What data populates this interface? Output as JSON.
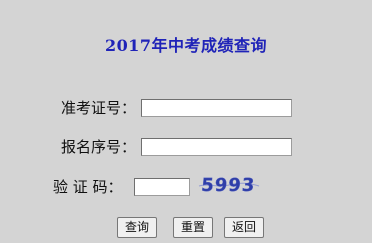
{
  "page": {
    "title": "2017年中考成绩查询"
  },
  "form": {
    "exam_number": {
      "label": "准考证号：",
      "value": "",
      "placeholder": ""
    },
    "registration_number": {
      "label": "报名序号：",
      "value": "",
      "placeholder": ""
    },
    "captcha": {
      "label": "验 证 码：",
      "value": "",
      "placeholder": "",
      "image_text": "5993"
    }
  },
  "buttons": {
    "query_label": "查询",
    "reset_label": "重置",
    "back_label": "返回"
  },
  "colors": {
    "background": "#d4d4d4",
    "title": "#1f23b8",
    "captcha_text": "#2f3ea8"
  }
}
